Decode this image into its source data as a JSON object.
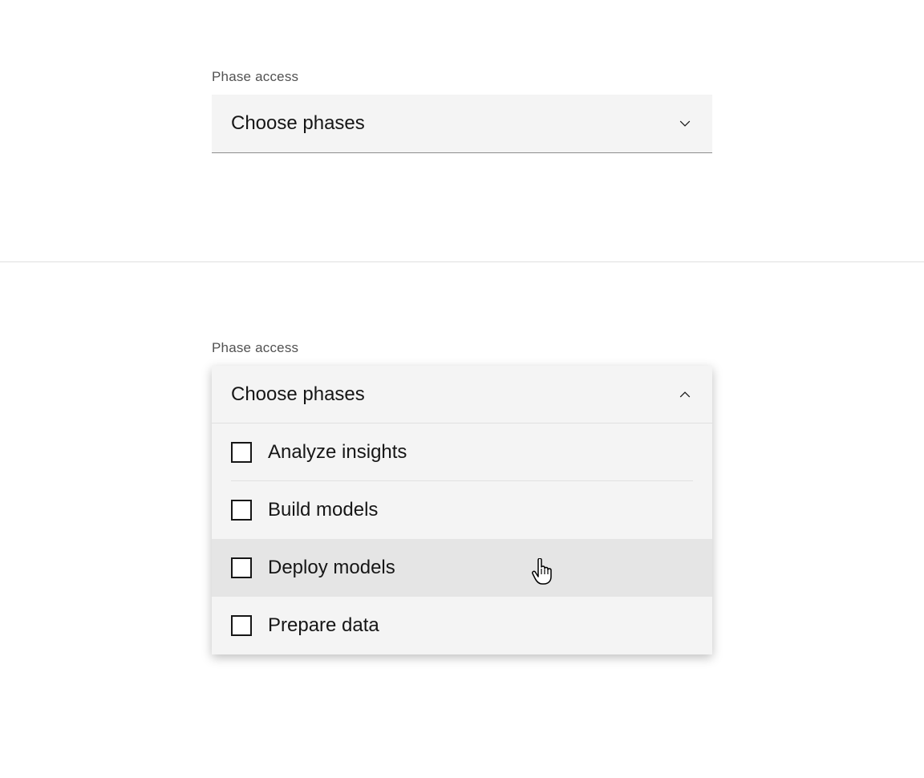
{
  "closed": {
    "label": "Phase access",
    "placeholder": "Choose phases"
  },
  "open": {
    "label": "Phase access",
    "placeholder": "Choose phases",
    "options": [
      {
        "label": "Analyze insights",
        "checked": false,
        "hovered": false
      },
      {
        "label": "Build models",
        "checked": false,
        "hovered": false
      },
      {
        "label": "Deploy models",
        "checked": false,
        "hovered": true
      },
      {
        "label": "Prepare data",
        "checked": false,
        "hovered": false
      }
    ]
  }
}
